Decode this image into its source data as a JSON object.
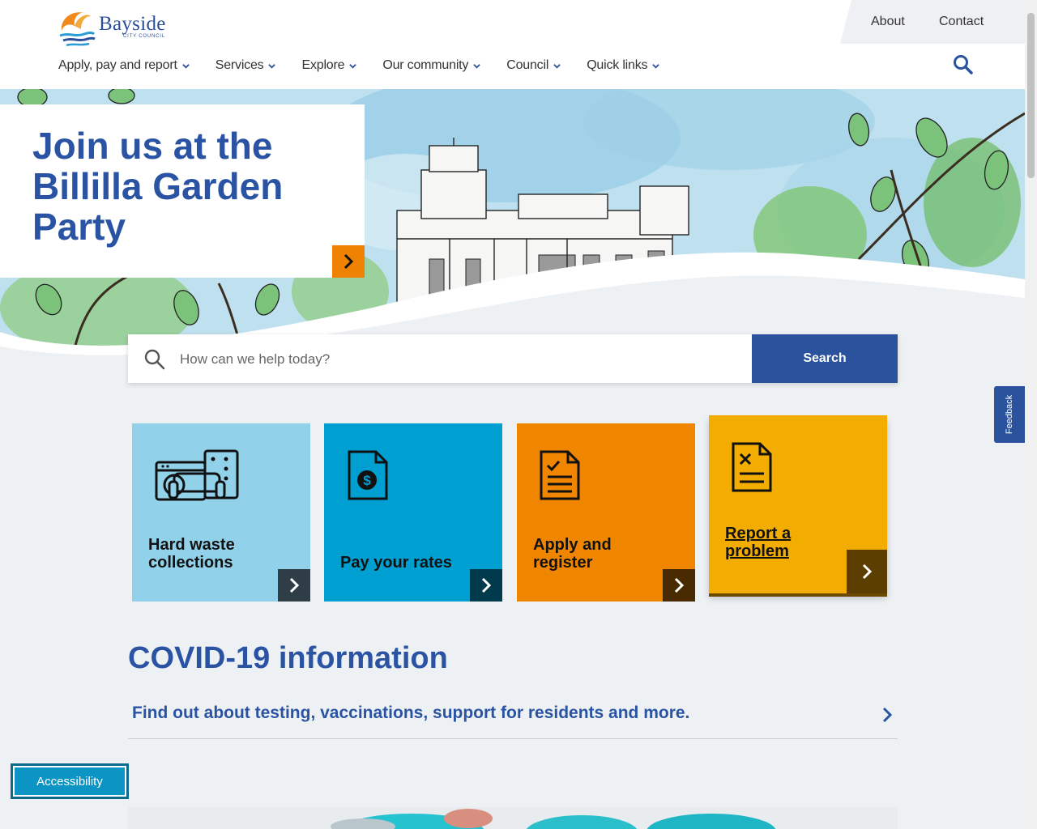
{
  "brand": {
    "name": "Bayside",
    "sub": "CITY COUNCIL"
  },
  "utility_nav": {
    "about": "About",
    "contact": "Contact"
  },
  "main_nav": [
    {
      "label": "Apply, pay and report"
    },
    {
      "label": "Services"
    },
    {
      "label": "Explore"
    },
    {
      "label": "Our community"
    },
    {
      "label": "Council"
    },
    {
      "label": "Quick links"
    }
  ],
  "hero": {
    "title": "Join us at the Billilla Garden Party"
  },
  "search": {
    "placeholder": "How can we help today?",
    "button": "Search"
  },
  "tiles": [
    {
      "label": "Hard waste collections",
      "color": "#91d2ea",
      "arrow_color": "#2f3e46",
      "icon": "furniture-appliance-icon"
    },
    {
      "label": "Pay your rates",
      "color": "#009fd1",
      "arrow_color": "#023a4d",
      "icon": "invoice-dollar-icon"
    },
    {
      "label": "Apply and register",
      "color": "#f08600",
      "arrow_color": "#4a2a00",
      "icon": "checklist-document-icon"
    },
    {
      "label": "Report a problem",
      "color": "#f2ad00",
      "arrow_color": "#5b3e00",
      "icon": "document-cross-icon"
    }
  ],
  "covid": {
    "title": "COVID-19 information",
    "link": "Find out about testing, vaccinations, support for residents and more."
  },
  "feedback": "Feedback",
  "accessibility": "Accessibility",
  "colors": {
    "brand_blue": "#2a54a3",
    "accent_orange": "#ef8200"
  }
}
